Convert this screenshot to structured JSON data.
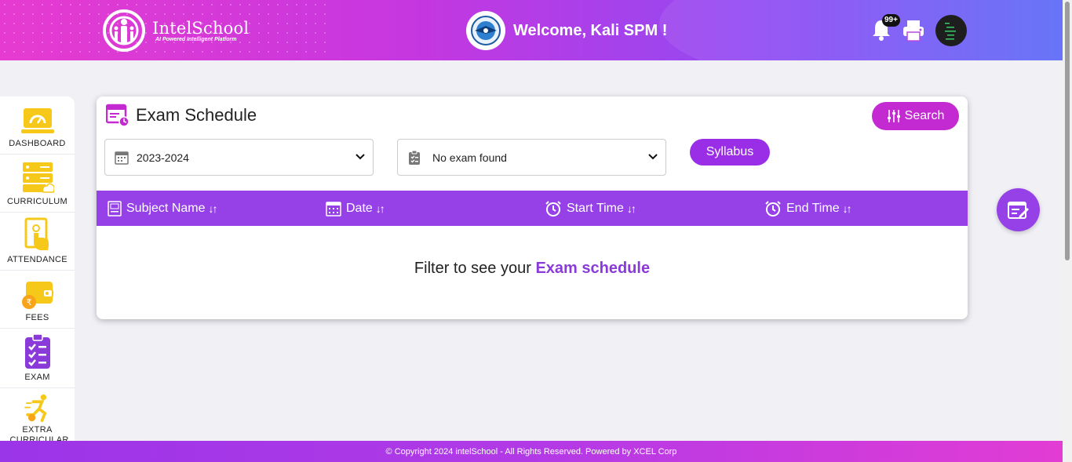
{
  "header": {
    "brand_title": "IntelSchool",
    "brand_subtitle": "AI Powered Intelligent Platform",
    "welcome": "Welcome, Kali SPM !",
    "notification_count": "99+"
  },
  "sidebar": {
    "items": [
      {
        "label": "DASHBOARD",
        "icon": "dashboard-icon"
      },
      {
        "label": "CURRICULUM",
        "icon": "curriculum-icon"
      },
      {
        "label": "ATTENDANCE",
        "icon": "attendance-icon"
      },
      {
        "label": "FEES",
        "icon": "fees-icon"
      },
      {
        "label": "EXAM",
        "icon": "exam-icon"
      },
      {
        "label": "EXTRA CURRICULAR",
        "icon": "extra-curricular-icon"
      }
    ]
  },
  "card": {
    "title": "Exam Schedule",
    "search_label": "Search",
    "year_select": "2023-2024",
    "exam_select": "No exam found",
    "syllabus_label": "Syllabus",
    "columns": [
      "Subject Name",
      "Date",
      "Start Time",
      "End Time"
    ],
    "empty_prefix": "Filter to see your",
    "empty_highlight": "Exam schedule"
  },
  "footer": {
    "text": "© Copyright 2024 intelSchool - All Rights Reserved. Powered by XCEL Corp"
  },
  "colors": {
    "primary_purple": "#9641e8",
    "magenta": "#c42ad2",
    "sidebar_icon_yellow": "#f6c81a"
  }
}
